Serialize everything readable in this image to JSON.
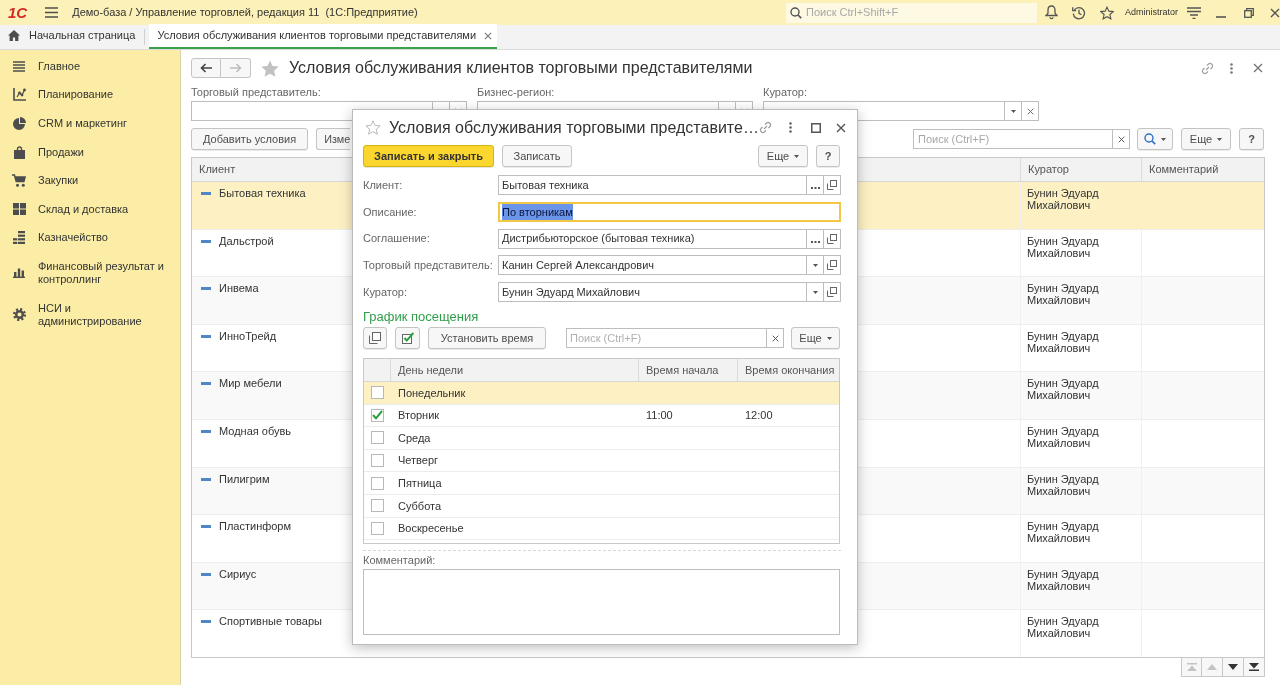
{
  "app_bar": {
    "logo": "1С",
    "title": "Демо-база / Управление торговлей, редакция 11  (1С:Предприятие)",
    "search": {
      "placeholder": "Поиск Ctrl+Shift+F"
    },
    "user": "Administrator"
  },
  "tabs": [
    {
      "kind": "home",
      "label": "Начальная страница",
      "selected": false
    },
    {
      "kind": "document",
      "label": "Условия обслуживания клиентов торговыми представителями",
      "selected": true
    }
  ],
  "sidebar": {
    "items": [
      {
        "label": "Главное"
      },
      {
        "label": "Планирование"
      },
      {
        "label": "CRM и маркетинг"
      },
      {
        "label": "Продажи"
      },
      {
        "label": "Закупки"
      },
      {
        "label": "Склад и доставка"
      },
      {
        "label": "Казначейство"
      },
      {
        "label": "Финансовый результат и контроллинг"
      },
      {
        "label": "НСИ и администрирование"
      }
    ]
  },
  "list_form": {
    "nav_buttons": [
      {
        "kind": "back",
        "disabled": false
      },
      {
        "kind": "forward",
        "disabled": true
      }
    ],
    "title": "Условия обслуживания клиентов торговыми представителями",
    "filters": [
      {
        "label": "Торговый представитель:"
      },
      {
        "label": "Бизнес-регион:"
      },
      {
        "label": "Куратор:"
      }
    ],
    "toolbar": {
      "buttons": [
        "Добавить условия",
        "Изме"
      ],
      "search": {
        "placeholder": "Поиск (Ctrl+F)"
      },
      "more_button": "Еще",
      "help_button": "?"
    },
    "table": {
      "columns": [
        "Клиент",
        "Куратор",
        "Комментарий"
      ],
      "rows": [
        {
          "client": "Бытовая техника",
          "curator": "Бунин Эдуард Михайлович",
          "selected": true
        },
        {
          "client": "Дальстрой",
          "curator": "Бунин Эдуард Михайлович",
          "selected": false
        },
        {
          "client": "Инвема",
          "curator": "Бунин Эдуард Михайлович",
          "selected": false
        },
        {
          "client": "ИнноТрейд",
          "curator": "Бунин Эдуард Михайлович",
          "selected": false
        },
        {
          "client": "Мир мебели",
          "curator": "Бунин Эдуард Михайлович",
          "selected": false
        },
        {
          "client": "Модная обувь",
          "curator": "Бунин Эдуард Михайлович",
          "selected": false
        },
        {
          "client": "Пилигрим",
          "curator": "Бунин Эдуард Михайлович",
          "selected": false
        },
        {
          "client": "Пластинформ",
          "curator": "Бунин Эдуард Михайлович",
          "selected": false
        },
        {
          "client": "Сириус",
          "curator": "Бунин Эдуард Михайлович",
          "selected": false
        },
        {
          "client": "Спортивные товары",
          "curator": "Бунин Эдуард Михайлович",
          "selected": false
        }
      ]
    },
    "pager": [
      {
        "kind": "first",
        "disabled": true
      },
      {
        "kind": "up",
        "disabled": true
      },
      {
        "kind": "down",
        "disabled": false
      },
      {
        "kind": "last",
        "disabled": false
      }
    ]
  },
  "dialog": {
    "title": "Условия обслуживания торговыми представите…",
    "buttons": {
      "save_close": "Записать и закрыть",
      "save": "Записать",
      "more": "Еще",
      "help": "?"
    },
    "fields": [
      {
        "kind": "choice",
        "label": "Клиент:",
        "value": "Бытовая техника",
        "focused": false
      },
      {
        "kind": "text",
        "label": "Описание:",
        "value": "По вторникам",
        "focused": true
      },
      {
        "kind": "choice",
        "label": "Соглашение:",
        "value": "Дистрибьюторское (бытовая техника)",
        "focused": false
      },
      {
        "kind": "dropdown",
        "label": "Торговый представитель:",
        "value": "Канин Сергей Александрович",
        "focused": false
      },
      {
        "kind": "dropdown",
        "label": "Куратор:",
        "value": "Бунин Эдуард Михайлович",
        "focused": false
      }
    ],
    "schedule": {
      "title": "График посещения",
      "toolbar": {
        "set_time_button": "Установить время",
        "search": {
          "placeholder": "Поиск (Ctrl+F)"
        },
        "more_button": "Еще"
      },
      "columns": [
        "День недели",
        "Время начала",
        "Время окончания"
      ],
      "rows": [
        {
          "day": "Понедельник",
          "checked": false,
          "selected": true
        },
        {
          "day": "Вторник",
          "start": "11:00",
          "end": "12:00",
          "checked": true,
          "selected": false
        },
        {
          "day": "Среда",
          "checked": false,
          "selected": false
        },
        {
          "day": "Четверг",
          "checked": false,
          "selected": false
        },
        {
          "day": "Пятница",
          "checked": false,
          "selected": false
        },
        {
          "day": "Суббота",
          "checked": false,
          "selected": false
        },
        {
          "day": "Воскресенье",
          "checked": false,
          "selected": false
        }
      ]
    },
    "comment": {
      "label": "Комментарий:"
    }
  }
}
